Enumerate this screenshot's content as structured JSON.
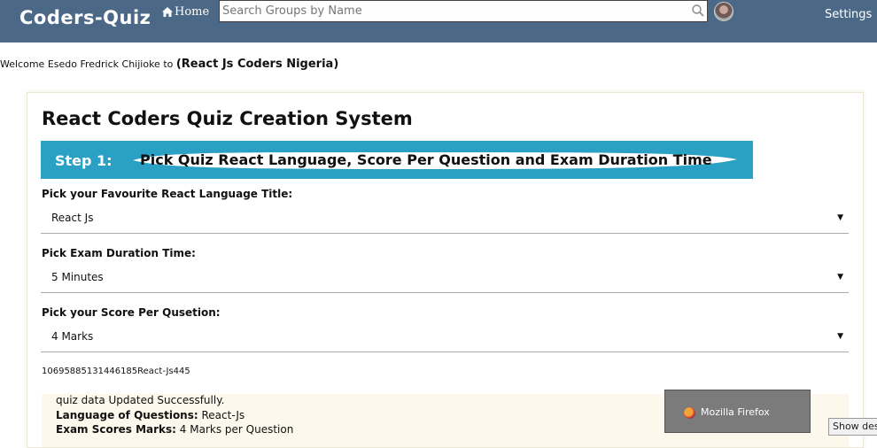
{
  "header": {
    "brand": "Coders-Quiz",
    "home_label": "Home",
    "search_placeholder": "Search Groups by Name",
    "settings_label": "Settings"
  },
  "welcome": {
    "prefix": "Welcome Esedo Fredrick Chijioke to ",
    "group": "(React Js Coders Nigeria)"
  },
  "card": {
    "title": "React Coders Quiz Creation System",
    "step_number": "Step 1:",
    "step_text": "Pick Quiz React Language, Score Per Question and Exam Duration Time"
  },
  "fields": [
    {
      "label": "Pick your Favourite React Language Title:",
      "value": "React Js"
    },
    {
      "label": "Pick Exam Duration Time:",
      "value": "5 Minutes"
    },
    {
      "label": "Pick your Score Per Qusetion:",
      "value": "4 Marks"
    }
  ],
  "code_text": "10695885131446185React-Js445",
  "alert": {
    "message": "quiz data Updated Successfully.",
    "language_label": "Language of Questions:",
    "language_value": " React-Js",
    "scores_label": "Exam Scores Marks:",
    "scores_value": " 4 Marks per Question"
  },
  "taskbar": {
    "firefox_label": "Mozilla Firefox",
    "show_desktop_label": "Show desktop"
  },
  "colors": {
    "topbar": "#4b6987",
    "step_banner": "#2aa1c4",
    "alert_bg": "#fcf9ec"
  },
  "icons": [
    "home-icon",
    "search-icon",
    "avatar",
    "dropdown-arrow-icon",
    "firefox-icon"
  ]
}
